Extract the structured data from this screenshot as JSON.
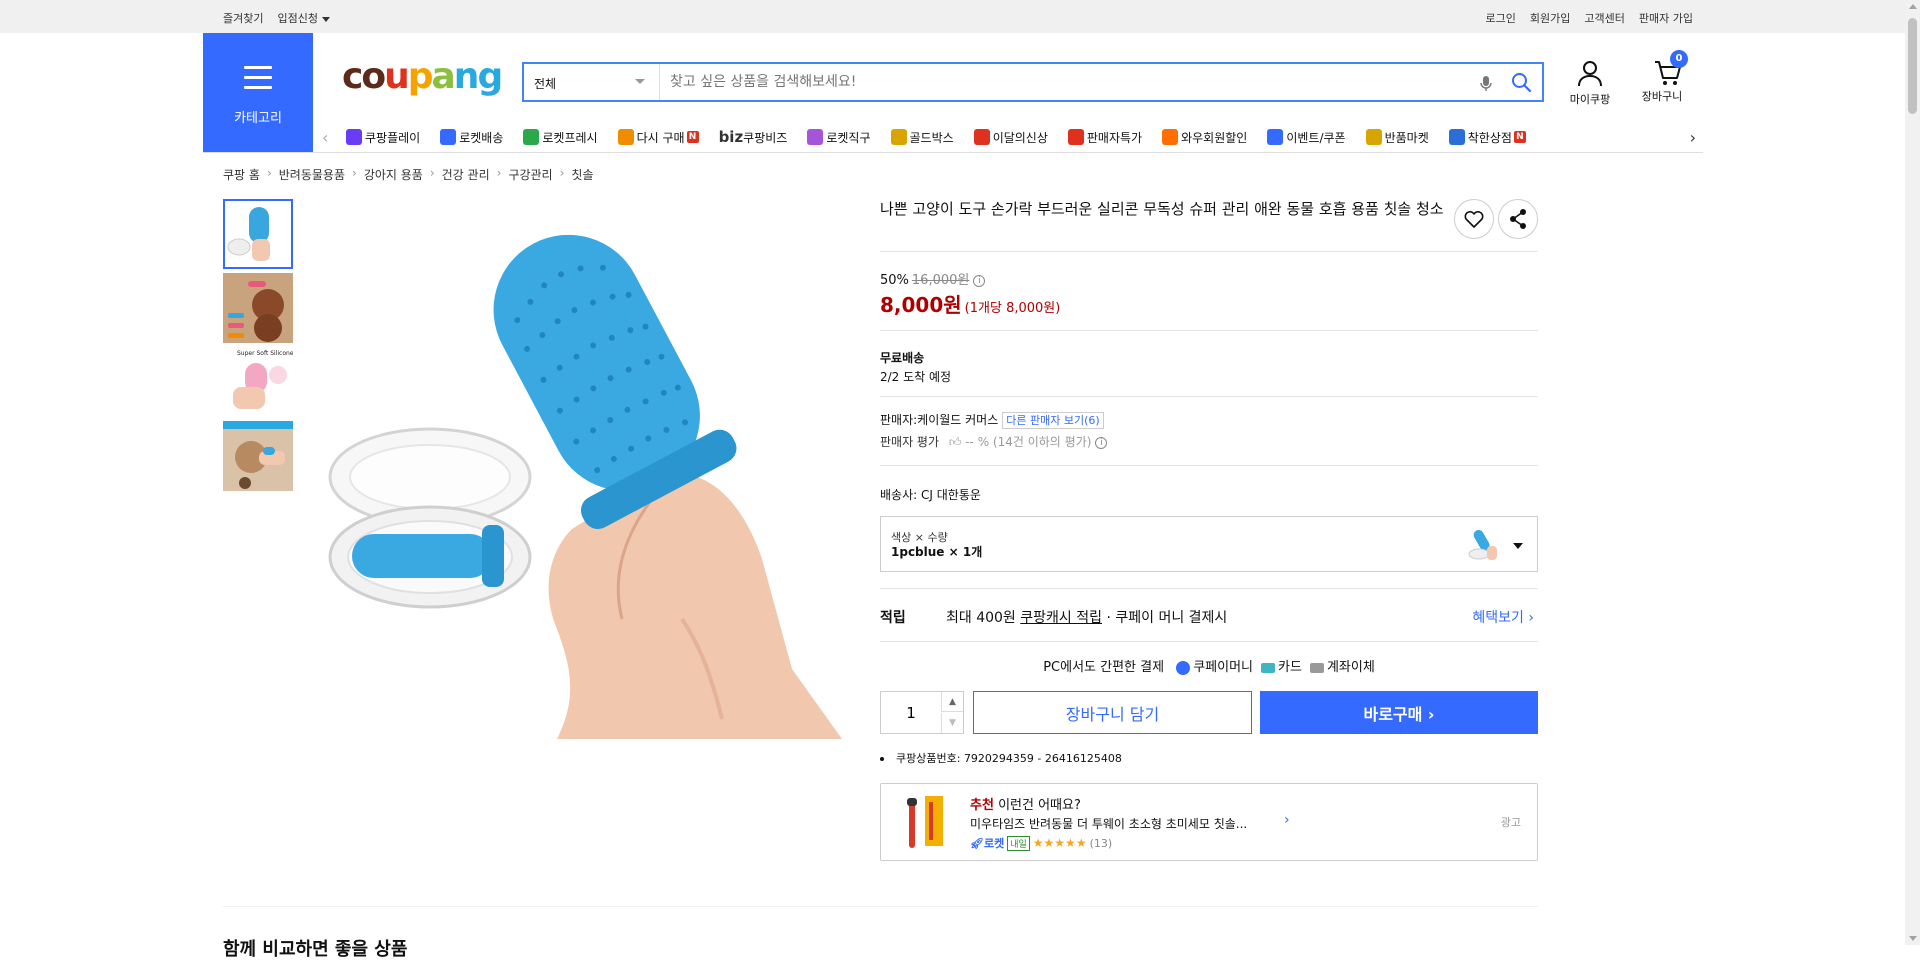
{
  "topbar": {
    "left": [
      "즐겨찾기",
      "입점신청"
    ],
    "right": [
      "로그인",
      "회원가입",
      "고객센터",
      "판매자 가입"
    ]
  },
  "header": {
    "category_label": "카테고리",
    "logo_text": "coupang",
    "search_select": "전체",
    "search_placeholder": "찾고 싶은 상품을 검색해보세요!",
    "mycoupang": "마이쿠팡",
    "cart": "장바구니",
    "cart_count": "0"
  },
  "nav": {
    "items": [
      {
        "label": "쿠팡플레이",
        "icon": "play-icon",
        "color": "#6a3cf5"
      },
      {
        "label": "로켓배송",
        "icon": "rocket-icon",
        "color": "#346aff"
      },
      {
        "label": "로켓프레시",
        "icon": "rocket-fresh-icon",
        "color": "#2aa84a"
      },
      {
        "label": "다시 구매",
        "icon": "rebuy-icon",
        "color": "#f08c00",
        "badge": "N"
      },
      {
        "label": "쿠팡비즈",
        "prefix": "biz",
        "icon": "biz-icon",
        "color": "#333333"
      },
      {
        "label": "로켓직구",
        "icon": "global-icon",
        "color": "#a455d8"
      },
      {
        "label": "골드박스",
        "icon": "goldbox-icon",
        "color": "#d8a400"
      },
      {
        "label": "이달의신상",
        "icon": "new-icon",
        "color": "#e0301e"
      },
      {
        "label": "판매자특가",
        "icon": "percent-icon",
        "color": "#e0301e"
      },
      {
        "label": "와우회원할인",
        "icon": "wow-icon",
        "color": "#ff6f00"
      },
      {
        "label": "이벤트/쿠폰",
        "icon": "coupon-icon",
        "color": "#346aff"
      },
      {
        "label": "반품마켓",
        "icon": "return-market-icon",
        "color": "#d8a400"
      },
      {
        "label": "착한상점",
        "icon": "good-store-icon",
        "color": "#2a6fd8",
        "badge": "N"
      }
    ]
  },
  "breadcrumb": [
    "쿠팡 홈",
    "반려동물용품",
    "강아지 용품",
    "건강 관리",
    "구강관리",
    "칫솔"
  ],
  "product": {
    "title": "나쁜 고양이 도구 손가락 부드러운 실리콘 무독성 슈퍼 관리 애완 동물 호흡 용품 칫솔 청소",
    "discount_rate": "50%",
    "original_price": "16,000원",
    "price": "8,000원",
    "unit_price": "(1개당 8,000원)",
    "shipping_title": "무료배송",
    "shipping_date": "2/2 도착 예정",
    "seller_label": "판매자:",
    "seller_name": "케이월드 커머스",
    "other_sellers": "다른 판매자 보기(6)",
    "seller_rating_label": "판매자 평가",
    "seller_rating_value": "-- % (14건 이하의 평가)",
    "courier_label": "배송사:",
    "courier_name": "CJ 대한통운",
    "option_label": "색상 × 수량",
    "option_value": "1pcblue × 1개",
    "reward_key": "적립",
    "reward_prefix": "최대 400원",
    "reward_link": "쿠팡캐시 적립",
    "reward_suffix": "· 쿠페이 머니 결제시",
    "reward_more": "혜택보기 ›",
    "pay_title": "PC에서도 간편한 결제",
    "pay_methods": [
      {
        "label": "쿠페이머니",
        "color": "#346aff",
        "shape": "dot"
      },
      {
        "label": "카드",
        "color": "#3fb4c6",
        "shape": "sq"
      },
      {
        "label": "계좌이체",
        "color": "#999999",
        "shape": "sq"
      }
    ],
    "quantity": "1",
    "add_to_cart": "장바구니 담기",
    "buy_now": "바로구매 ›",
    "product_id_label": "쿠팡상품번호:",
    "product_id": "7920294359 - 26416125408"
  },
  "recommend": {
    "tag": "추천",
    "headline": "이런건 어때요?",
    "item": "미우타임즈 반려동물 더 투웨이 초소형 초미세모 칫솔...",
    "rocket": "로켓",
    "tomorrow": "내일",
    "stars": "★★★★★",
    "count": "(13)",
    "ad": "광고"
  },
  "bottom_title": "함께 비교하면 좋을 상품"
}
